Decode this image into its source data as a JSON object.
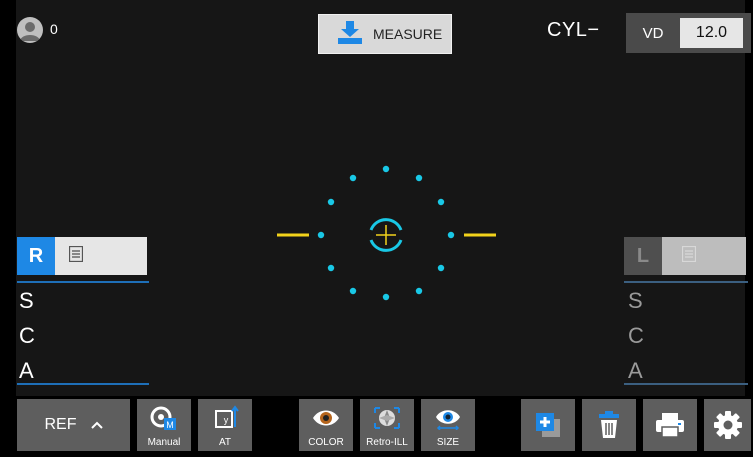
{
  "topbar": {
    "user_count": "0",
    "measure_label": "MEASURE",
    "cyl_label": "CYL−",
    "vd_label": "VD",
    "vd_value": "12.0"
  },
  "right_eye": {
    "tab_label": "R",
    "rows": [
      "S",
      "C",
      "A"
    ]
  },
  "left_eye": {
    "tab_label": "L",
    "rows": [
      "S",
      "C",
      "A"
    ]
  },
  "toolbar": {
    "ref_label": "REF",
    "manual_label": "Manual",
    "at_label": "AT",
    "color_label": "COLOR",
    "retro_label": "Retro-ILL",
    "size_label": "SIZE"
  },
  "colors": {
    "accent_blue": "#1e88e5",
    "target_cyan": "#19c8e6",
    "crosshair_yellow": "#f2d21b",
    "panel_gray": "#5e5e5e"
  }
}
